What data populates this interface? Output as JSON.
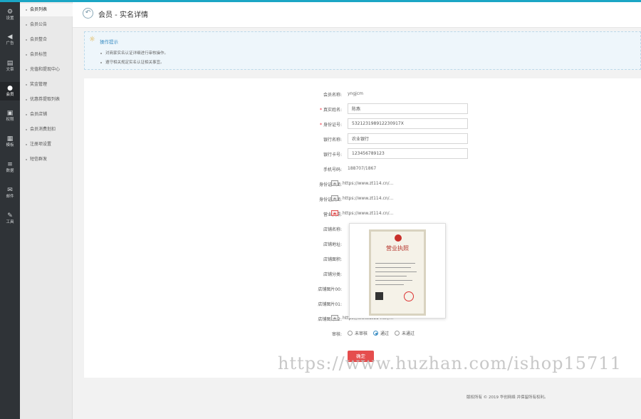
{
  "rail": {
    "items": [
      {
        "label": "设置",
        "icon": "gear-icon"
      },
      {
        "label": "广告",
        "icon": "speaker-icon"
      },
      {
        "label": "文章",
        "icon": "document-icon"
      },
      {
        "label": "会员",
        "icon": "user-icon"
      },
      {
        "label": "权限",
        "icon": "lock-icon"
      },
      {
        "label": "模板",
        "icon": "grid-icon"
      },
      {
        "label": "数据",
        "icon": "database-icon"
      },
      {
        "label": "邮件",
        "icon": "mail-icon"
      },
      {
        "label": "工具",
        "icon": "tools-icon"
      }
    ]
  },
  "submenu": {
    "items": [
      "会员列表",
      "会员公告",
      "会员整合",
      "会员标签",
      "充值和提现中心",
      "奖金管理",
      "优惠券提取列表",
      "会员店铺",
      "会员消费划扣",
      "注册项设置",
      "短信群发"
    ]
  },
  "header": {
    "title": "会员 - 实名详情"
  },
  "tips": {
    "title": "操作提示",
    "lines": [
      "对商家实名认证详细进行审核操作。",
      "遵守相关规定实名认证相关事宜。"
    ]
  },
  "form": {
    "username_label": "会员名称:",
    "username_value": "yngjcm",
    "realname_label": "真实姓名:",
    "realname_value": "陈燕",
    "idcard_label": "身份证号:",
    "idcard_value": "532123198912230917X",
    "bank_label": "银行名称:",
    "bank_value": "农业银行",
    "card_label": "银行卡号:",
    "card_value": "123456789123",
    "phone_label": "手机号码:",
    "phone_value": "188707/1867",
    "id_front_label": "身份证正面:",
    "id_front_value": "https://www.zt114.cn/...",
    "id_back_label": "身份证反面:",
    "id_back_value": "https://www.zt114.cn/...",
    "license_label": "营业执照:",
    "license_value": "https://www.zt114.cn/...",
    "shop_name_label": "店铺名称:",
    "shop_addr_label": "店铺地址:",
    "shop_area_label": "店铺面积:",
    "shop_cat_label": "店铺分类:",
    "shop_img0_label": "店铺图片00:",
    "shop_img1_label": "店铺图片01:",
    "shop_img2_label": "店铺图片02:",
    "shop_img2_value": "https://www.zt114.cn/...",
    "audit_label": "审核:",
    "audit_options": [
      "未审核",
      "通过",
      "未通过"
    ],
    "submit_label": "确定"
  },
  "license_title": "营业执照",
  "footer": "版权所有 © 2019 华创网络 并保留所有权利。",
  "watermark": "https://www.huzhan.com/ishop15711",
  "colors": {
    "accent": "#1ba6c5",
    "submit": "#e54d4d",
    "tip": "#3e8fc4"
  }
}
